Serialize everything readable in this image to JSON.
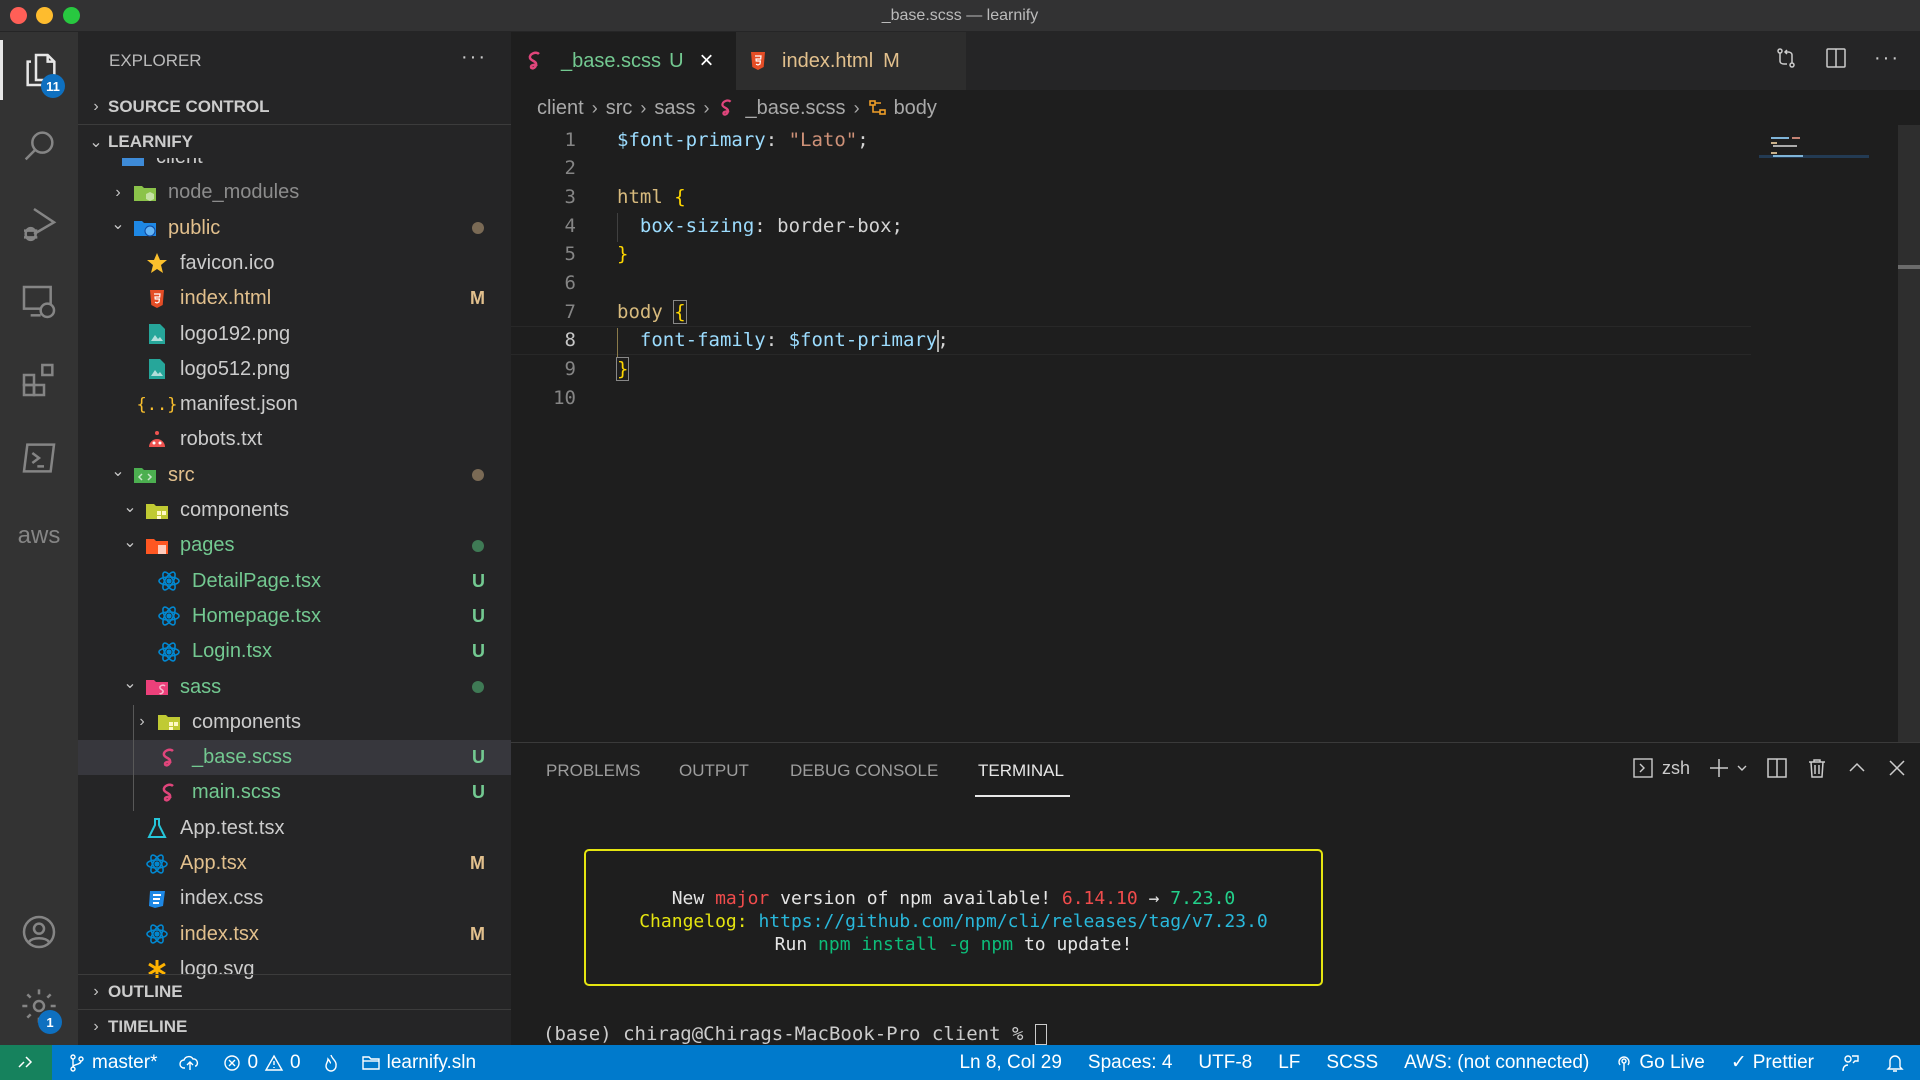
{
  "window": {
    "title": "_base.scss — learnify"
  },
  "activity_bar": {
    "items": [
      {
        "name": "explorer",
        "badge": "11"
      },
      {
        "name": "search"
      },
      {
        "name": "run-and-debug"
      },
      {
        "name": "remote-explorer"
      },
      {
        "name": "extensions"
      },
      {
        "name": "terminal-view"
      },
      {
        "name": "aws",
        "label": "aws"
      }
    ],
    "accounts": {
      "name": "accounts"
    },
    "manage": {
      "name": "manage",
      "badge": "1"
    }
  },
  "sidebar": {
    "title": "EXPLORER",
    "more": "···",
    "sections": {
      "source_control": "SOURCE CONTROL",
      "workspace": "LEARNIFY",
      "outline": "OUTLINE",
      "timeline": "TIMELINE"
    },
    "tree": [
      {
        "label": "client",
        "depth": 0,
        "kind": "folder-partial"
      },
      {
        "label": "node_modules",
        "depth": 1,
        "kind": "folder-node",
        "expanded": false,
        "status": "ignored"
      },
      {
        "label": "public",
        "depth": 1,
        "kind": "folder-public",
        "expanded": true,
        "dot": "modified"
      },
      {
        "label": "favicon.ico",
        "depth": 2,
        "kind": "favicon"
      },
      {
        "label": "index.html",
        "depth": 2,
        "kind": "html",
        "decoration": "M"
      },
      {
        "label": "logo192.png",
        "depth": 2,
        "kind": "image"
      },
      {
        "label": "logo512.png",
        "depth": 2,
        "kind": "image"
      },
      {
        "label": "manifest.json",
        "depth": 2,
        "kind": "json"
      },
      {
        "label": "robots.txt",
        "depth": 2,
        "kind": "robot"
      },
      {
        "label": "src",
        "depth": 1,
        "kind": "folder-src",
        "expanded": true,
        "dot": "modified"
      },
      {
        "label": "components",
        "depth": 2,
        "kind": "folder-components",
        "expanded": true
      },
      {
        "label": "pages",
        "depth": 2,
        "kind": "folder-pages",
        "expanded": true,
        "dot": "untracked"
      },
      {
        "label": "DetailPage.tsx",
        "depth": 3,
        "kind": "react",
        "decoration": "U"
      },
      {
        "label": "Homepage.tsx",
        "depth": 3,
        "kind": "react",
        "decoration": "U"
      },
      {
        "label": "Login.tsx",
        "depth": 3,
        "kind": "react",
        "decoration": "U"
      },
      {
        "label": "sass",
        "depth": 2,
        "kind": "folder-sass",
        "expanded": true,
        "dot": "untracked"
      },
      {
        "label": "components",
        "depth": 3,
        "kind": "folder-components",
        "expanded": false
      },
      {
        "label": "_base.scss",
        "depth": 3,
        "kind": "sass",
        "decoration": "U",
        "selected": true
      },
      {
        "label": "main.scss",
        "depth": 3,
        "kind": "sass",
        "decoration": "U"
      },
      {
        "label": "App.test.tsx",
        "depth": 2,
        "kind": "test"
      },
      {
        "label": "App.tsx",
        "depth": 2,
        "kind": "react",
        "decoration": "M"
      },
      {
        "label": "index.css",
        "depth": 2,
        "kind": "css"
      },
      {
        "label": "index.tsx",
        "depth": 2,
        "kind": "react",
        "decoration": "M"
      },
      {
        "label": "logo.svg",
        "depth": 2,
        "kind": "svg"
      }
    ]
  },
  "tabs": [
    {
      "label": "_base.scss",
      "decoration": "U",
      "active": true,
      "close": "×"
    },
    {
      "label": "index.html",
      "decoration": "M",
      "active": false
    }
  ],
  "breadcrumb": [
    "client",
    "src",
    "sass",
    "_base.scss",
    "body"
  ],
  "editor": {
    "current_line": 8,
    "lines": [
      [
        {
          "t": "$font-primary",
          "c": "var"
        },
        {
          "t": ": ",
          "c": "p"
        },
        {
          "t": "\"Lato\"",
          "c": "str"
        },
        {
          "t": ";",
          "c": "p"
        }
      ],
      [],
      [
        {
          "t": "html ",
          "c": "sel"
        },
        {
          "t": "{",
          "c": "br"
        }
      ],
      [
        {
          "t": "  box-sizing",
          "c": "var"
        },
        {
          "t": ": border-box;",
          "c": "p"
        }
      ],
      [
        {
          "t": "}",
          "c": "br"
        }
      ],
      [],
      [
        {
          "t": "body ",
          "c": "sel"
        },
        {
          "t": "{",
          "c": "br"
        }
      ],
      [
        {
          "t": "  font-family",
          "c": "var"
        },
        {
          "t": ": ",
          "c": "p"
        },
        {
          "t": "$font-primary",
          "c": "var"
        },
        {
          "t": "|",
          "c": "cursor"
        },
        {
          "t": ";",
          "c": "p"
        }
      ],
      [
        {
          "t": "}",
          "c": "br"
        }
      ],
      []
    ]
  },
  "panel": {
    "tabs": [
      "PROBLEMS",
      "OUTPUT",
      "DEBUG CONSOLE",
      "TERMINAL"
    ],
    "active_tab": "TERMINAL",
    "shell": "zsh",
    "npm_notice": {
      "line1": {
        "a": "New ",
        "major": "major",
        "b": " version of npm available! ",
        "old": "6.14.10",
        "arrow": " → ",
        "new": "7.23.0"
      },
      "line2": {
        "label": "Changelog:",
        "url": "https://github.com/npm/cli/releases/tag/v7.23.0"
      },
      "line3": {
        "a": "Run ",
        "cmd": "npm install -g npm",
        "b": " to update!"
      }
    },
    "prompt": "(base) chirag@Chirags-MacBook-Pro client % "
  },
  "statusbar": {
    "branch": "master*",
    "errors": "0",
    "warnings": "0",
    "solution": "learnify.sln",
    "position": "Ln 8, Col 29",
    "spaces": "Spaces: 4",
    "encoding": "UTF-8",
    "eol": "LF",
    "language": "SCSS",
    "aws": "AWS: (not connected)",
    "go_live": "Go Live",
    "prettier": "Prettier"
  },
  "colors": {
    "statusbar": "#007acc",
    "remote": "#16825d",
    "untracked": "#73c991",
    "modified": "#e2c08d",
    "badge": "#0e70c0"
  }
}
